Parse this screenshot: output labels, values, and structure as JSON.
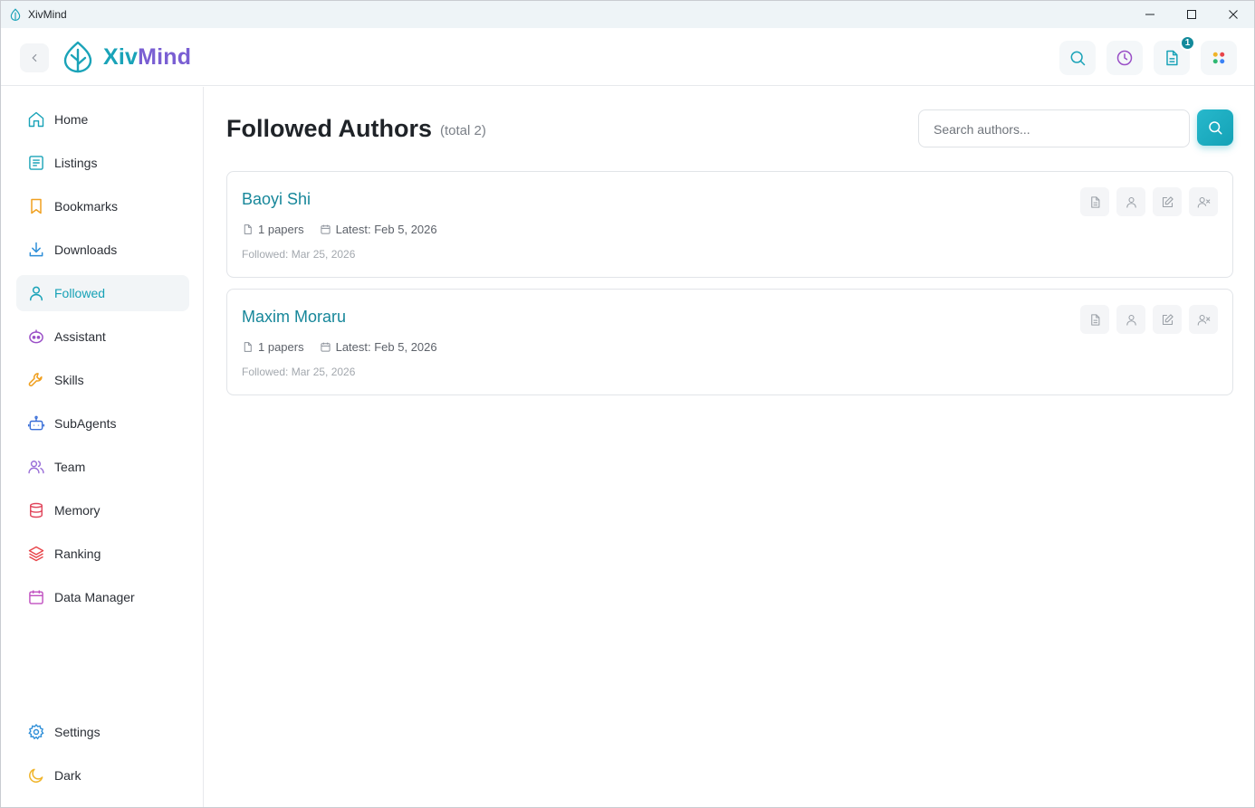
{
  "window": {
    "title": "XivMind"
  },
  "header": {
    "brand_part1": "Xiv",
    "brand_part2": "Mind",
    "doc_badge": "1",
    "buttons": [
      "search-icon",
      "history-icon",
      "document-icon",
      "apps-icon"
    ]
  },
  "colors": {
    "accent": "#16a1b6",
    "brand_purple": "#7a5fd3",
    "active_bg": "#f2f5f7"
  },
  "sidebar": {
    "items": [
      {
        "label": "Home",
        "icon": "home-icon",
        "active": false
      },
      {
        "label": "Listings",
        "icon": "list-icon",
        "active": false
      },
      {
        "label": "Bookmarks",
        "icon": "bookmark-icon",
        "active": false
      },
      {
        "label": "Downloads",
        "icon": "download-icon",
        "active": false
      },
      {
        "label": "Followed",
        "icon": "user-icon",
        "active": true
      },
      {
        "label": "Assistant",
        "icon": "bot-icon",
        "active": false
      },
      {
        "label": "Skills",
        "icon": "wrench-icon",
        "active": false
      },
      {
        "label": "SubAgents",
        "icon": "robot-icon",
        "active": false
      },
      {
        "label": "Team",
        "icon": "users-icon",
        "active": false
      },
      {
        "label": "Memory",
        "icon": "database-icon",
        "active": false
      },
      {
        "label": "Ranking",
        "icon": "layers-icon",
        "active": false
      },
      {
        "label": "Data Manager",
        "icon": "calendar-icon",
        "active": false
      }
    ],
    "bottom": [
      {
        "label": "Settings",
        "icon": "gear-icon"
      },
      {
        "label": "Dark",
        "icon": "moon-icon"
      }
    ]
  },
  "main": {
    "title": "Followed Authors",
    "total": "(total 2)",
    "search": {
      "placeholder": "Search authors...",
      "value": ""
    },
    "authors": [
      {
        "name": "Baoyi Shi",
        "papers": "1 papers",
        "latest": "Latest: Feb 5, 2026",
        "followed": "Followed: Mar 25, 2026"
      },
      {
        "name": "Maxim Moraru",
        "papers": "1 papers",
        "latest": "Latest: Feb 5, 2026",
        "followed": "Followed: Mar 25, 2026"
      }
    ],
    "card_actions": [
      "papers-icon",
      "profile-icon",
      "edit-icon",
      "unfollow-icon"
    ]
  }
}
